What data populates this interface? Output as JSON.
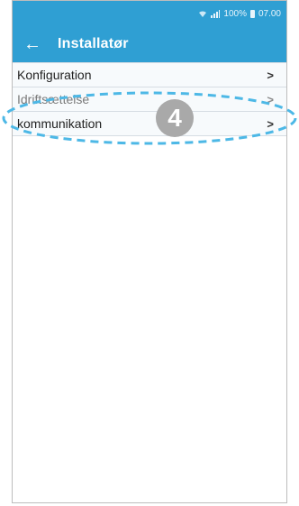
{
  "status_bar": {
    "battery_text": "100%",
    "time": "07.00",
    "icons": [
      "wifi-icon",
      "signal-icon",
      "battery-icon"
    ]
  },
  "app_bar": {
    "back_glyph": "←",
    "title": "Installatør"
  },
  "menu": {
    "items": [
      {
        "label": "Konfiguration",
        "chevron": ">"
      },
      {
        "label": "Idriftsættelse",
        "chevron": ">"
      },
      {
        "label": "kommunikation",
        "chevron": ">"
      }
    ]
  },
  "annotation": {
    "step_number": "4",
    "highlight_color": "#4db8e6",
    "badge_color": "#a9a9a9"
  },
  "colors": {
    "app_bar": "#2f9fd3",
    "list_background": "#f7fafc"
  }
}
